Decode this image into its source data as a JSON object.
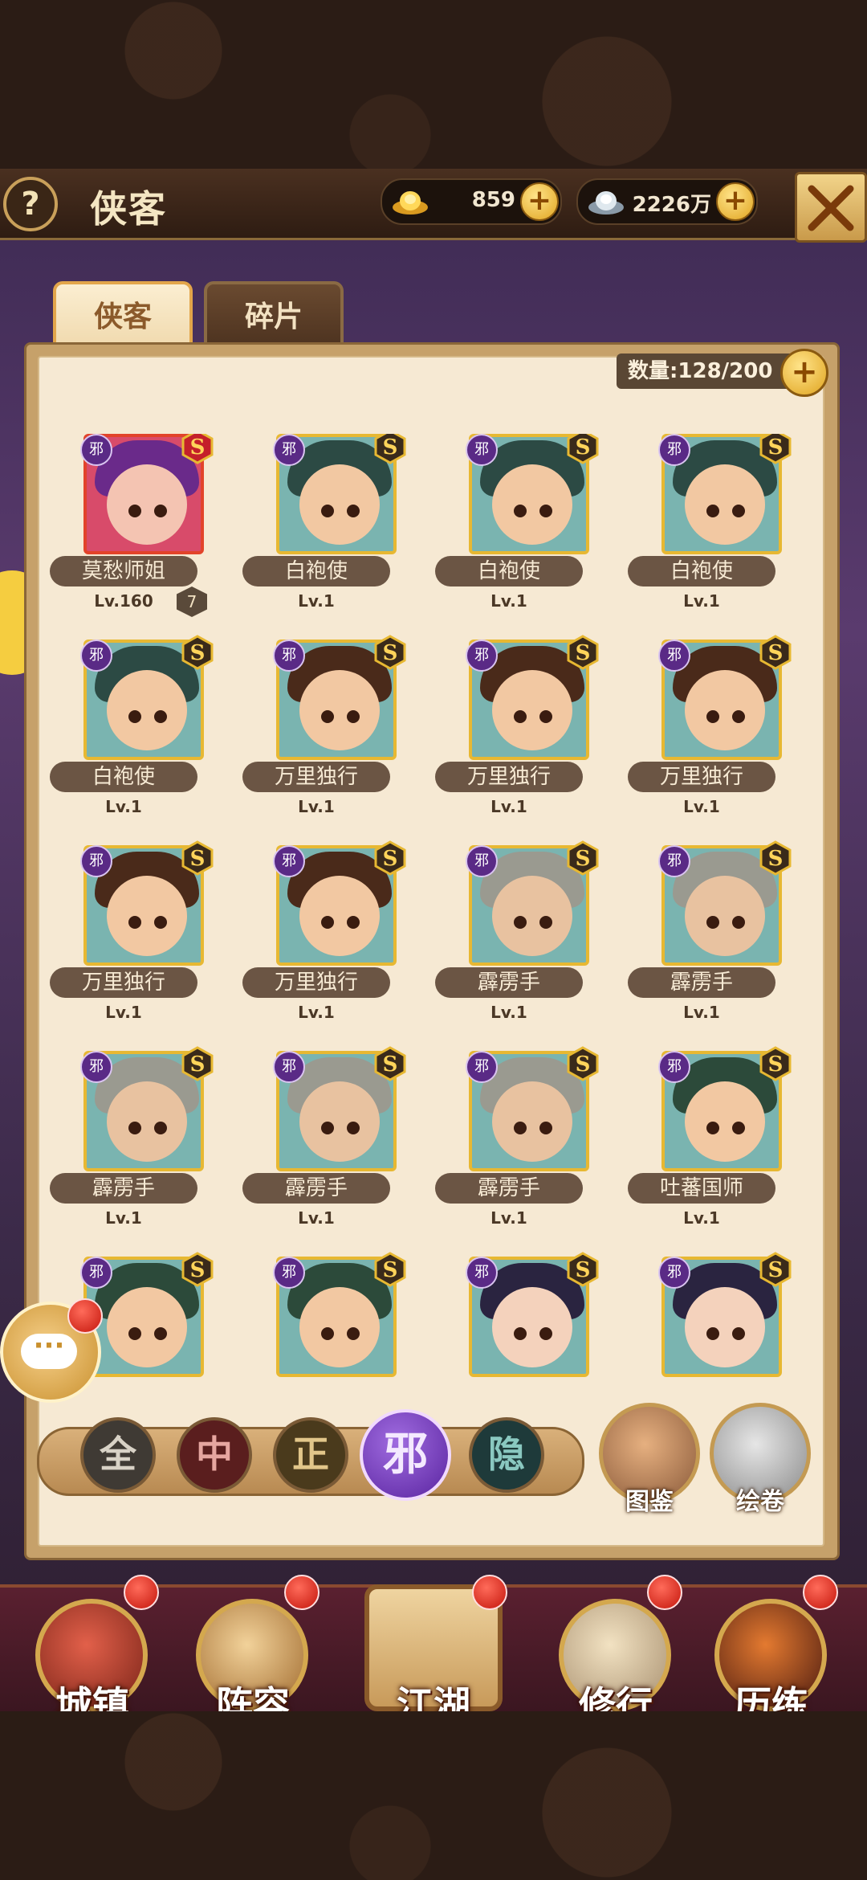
{
  "header": {
    "help_label": "?",
    "title": "侠客",
    "gold": {
      "value": "859",
      "icon": "gold-ingot-icon"
    },
    "silver": {
      "value": "2226万",
      "icon": "silver-ingot-icon"
    },
    "plus_label": "+"
  },
  "tabs": [
    {
      "label": "侠客",
      "active": true
    },
    {
      "label": "碎片",
      "active": false
    }
  ],
  "count": {
    "label": "数量:128/200",
    "plus": "+"
  },
  "heroes": [
    {
      "name": "莫愁师姐",
      "level": "Lv.160",
      "stars": "7",
      "faction": "邪",
      "rank": "S",
      "frame": "red",
      "hair": "#6a2a8a",
      "skin": "#f4c4b2"
    },
    {
      "name": "白袍使",
      "level": "Lv.1",
      "faction": "邪",
      "rank": "S",
      "frame": "gold",
      "hair": "#2c4a44",
      "skin": "#f2c8a2"
    },
    {
      "name": "白袍使",
      "level": "Lv.1",
      "faction": "邪",
      "rank": "S",
      "frame": "gold",
      "hair": "#2c4a44",
      "skin": "#f2c8a2"
    },
    {
      "name": "白袍使",
      "level": "Lv.1",
      "faction": "邪",
      "rank": "S",
      "frame": "gold",
      "hair": "#2c4a44",
      "skin": "#f2c8a2"
    },
    {
      "name": "白袍使",
      "level": "Lv.1",
      "faction": "邪",
      "rank": "S",
      "frame": "gold",
      "hair": "#2c4a44",
      "skin": "#f2c8a2"
    },
    {
      "name": "万里独行",
      "level": "Lv.1",
      "faction": "邪",
      "rank": "S",
      "frame": "gold",
      "hair": "#4a2a1a",
      "skin": "#f2c8a2"
    },
    {
      "name": "万里独行",
      "level": "Lv.1",
      "faction": "邪",
      "rank": "S",
      "frame": "gold",
      "hair": "#4a2a1a",
      "skin": "#f2c8a2"
    },
    {
      "name": "万里独行",
      "level": "Lv.1",
      "faction": "邪",
      "rank": "S",
      "frame": "gold",
      "hair": "#4a2a1a",
      "skin": "#f2c8a2"
    },
    {
      "name": "万里独行",
      "level": "Lv.1",
      "faction": "邪",
      "rank": "S",
      "frame": "gold",
      "hair": "#4a2a1a",
      "skin": "#f2c8a2"
    },
    {
      "name": "万里独行",
      "level": "Lv.1",
      "faction": "邪",
      "rank": "S",
      "frame": "gold",
      "hair": "#4a2a1a",
      "skin": "#f2c8a2"
    },
    {
      "name": "霹雳手",
      "level": "Lv.1",
      "faction": "邪",
      "rank": "S",
      "frame": "gold",
      "hair": "#9a9a90",
      "skin": "#e8c2a0"
    },
    {
      "name": "霹雳手",
      "level": "Lv.1",
      "faction": "邪",
      "rank": "S",
      "frame": "gold",
      "hair": "#9a9a90",
      "skin": "#e8c2a0"
    },
    {
      "name": "霹雳手",
      "level": "Lv.1",
      "faction": "邪",
      "rank": "S",
      "frame": "gold",
      "hair": "#9a9a90",
      "skin": "#e8c2a0"
    },
    {
      "name": "霹雳手",
      "level": "Lv.1",
      "faction": "邪",
      "rank": "S",
      "frame": "gold",
      "hair": "#9a9a90",
      "skin": "#e8c2a0"
    },
    {
      "name": "霹雳手",
      "level": "Lv.1",
      "faction": "邪",
      "rank": "S",
      "frame": "gold",
      "hair": "#9a9a90",
      "skin": "#e8c2a0"
    },
    {
      "name": "吐蕃国师",
      "level": "Lv.1",
      "faction": "邪",
      "rank": "S",
      "frame": "gold",
      "hair": "#2c4a3a",
      "skin": "#f2c8a2"
    },
    {
      "name": "",
      "level": "",
      "faction": "邪",
      "rank": "S",
      "frame": "gold",
      "hair": "#2c4a3a",
      "skin": "#f2c8a2"
    },
    {
      "name": "",
      "level": "",
      "faction": "邪",
      "rank": "S",
      "frame": "gold",
      "hair": "#2c4a3a",
      "skin": "#f2c8a2"
    },
    {
      "name": "",
      "level": "",
      "faction": "邪",
      "rank": "S",
      "frame": "gold",
      "hair": "#2a2440",
      "skin": "#f4d2bc"
    },
    {
      "name": "",
      "level": "",
      "faction": "邪",
      "rank": "S",
      "frame": "gold",
      "hair": "#2a2440",
      "skin": "#f4d2bc"
    }
  ],
  "filters": [
    {
      "label": "全",
      "id": "all"
    },
    {
      "label": "中",
      "id": "mid"
    },
    {
      "label": "正",
      "id": "zheng"
    },
    {
      "label": "邪",
      "id": "xie",
      "selected": true
    },
    {
      "label": "隐",
      "id": "yin"
    }
  ],
  "side_buttons": {
    "atlas": "图鉴",
    "scroll": "绘卷"
  },
  "chat": {
    "icon": "chat-bubble-icon",
    "dots": "···"
  },
  "nav": [
    {
      "label": "城镇",
      "icon": "town-icon"
    },
    {
      "label": "阵容",
      "icon": "lineup-icon"
    },
    {
      "label": "江湖",
      "icon": "jianghu-scroll-icon"
    },
    {
      "label": "修行",
      "icon": "training-icon"
    },
    {
      "label": "历练",
      "icon": "experience-icon"
    }
  ],
  "colors": {
    "accent_gold": "#e7b832",
    "faction_xie": "#5a2a86",
    "notify_red": "#c4160c"
  }
}
